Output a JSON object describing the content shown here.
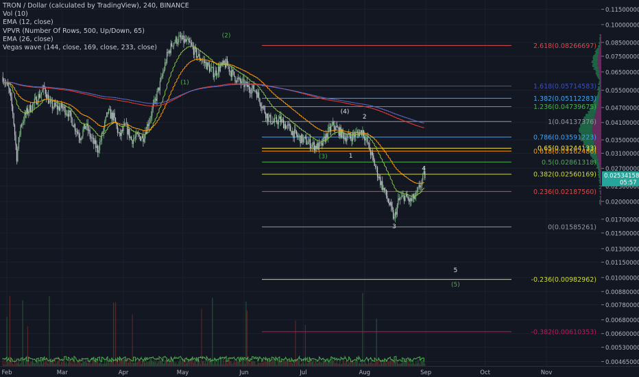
{
  "header": {
    "title": "TRON / Dollar (calculated by TradingView), 240, BINANCE",
    "indicators": [
      "Vol (10)",
      "EMA (12, close)",
      "VPVR (Number Of Rows, 500, Up/Down, 65)",
      "EMA (26, close)",
      "Vegas wave (144, close, 169, close, 233, close)"
    ]
  },
  "price_axis": {
    "ticks": [
      "0.11500000",
      "0.10000000",
      "0.08500000",
      "0.07500000",
      "0.06500000",
      "0.05500000",
      "0.04700000",
      "0.04100000",
      "0.03500000",
      "0.03100000",
      "0.02700000",
      "0.02300000",
      "0.02000000",
      "0.01700000",
      "0.01500000",
      "0.01300000",
      "0.01150000",
      "0.01000000",
      "0.00880000",
      "0.00780000",
      "0.00680000",
      "0.00600000",
      "0.00530000",
      "0.00465000"
    ],
    "last_price": "0.02534158",
    "countdown": "05:57",
    "last_price_color": "#26a69a"
  },
  "time_axis": {
    "labels": [
      "Feb",
      "Mar",
      "Apr",
      "May",
      "Jun",
      "Jul",
      "Aug",
      "Sep",
      "Oct",
      "Nov"
    ]
  },
  "fib_levels": [
    {
      "ratio": "2.618",
      "price": 0.08266697,
      "color": "#e04848"
    },
    {
      "ratio": "1.618",
      "price": 0.05714583,
      "color": "#3f51b5"
    },
    {
      "ratio": "1.382",
      "price": 0.05112283,
      "color": "#42a5f5"
    },
    {
      "ratio": "1.236",
      "price": 0.04739675,
      "color": "#4caf50"
    },
    {
      "ratio": "1",
      "price": 0.04137376,
      "color": "#9598a1"
    },
    {
      "ratio": "0.786",
      "price": 0.03591223,
      "color": "#42a5f5"
    },
    {
      "ratio": "0.65",
      "price": 0.03244133,
      "color": "#ffeb3b"
    },
    {
      "ratio": "0.618",
      "price": 0.03162486,
      "color": "#ff9800"
    },
    {
      "ratio": "0.5",
      "price": 0.02861318,
      "color": "#4caf50"
    },
    {
      "ratio": "0.382",
      "price": 0.02560169,
      "color": "#cddc39"
    },
    {
      "ratio": "0.236",
      "price": 0.0218756,
      "color": "#e04848"
    },
    {
      "ratio": "0",
      "price": 0.01585261,
      "color": "#9598a1"
    },
    {
      "ratio": "-0.236",
      "price": 0.00982962,
      "color": "#cddc39"
    },
    {
      "ratio": "-0.382",
      "price": 0.00610353,
      "color": "#c2185b"
    }
  ],
  "wave_labels": [
    {
      "text": "(1)",
      "date": "2018-05-02",
      "price": 0.058,
      "color": "#4caf50"
    },
    {
      "text": "(2)",
      "date": "2018-05-23",
      "price": 0.089,
      "color": "#4caf50"
    },
    {
      "text": "(3)",
      "date": "2018-07-11",
      "price": 0.0296,
      "color": "#4caf50"
    },
    {
      "text": "(4)",
      "date": "2018-07-22",
      "price": 0.0445,
      "color": "#e0e0e0"
    },
    {
      "text": "1",
      "date": "2018-07-25",
      "price": 0.0298,
      "color": "#e0e0e0"
    },
    {
      "text": "2",
      "date": "2018-08-01",
      "price": 0.0425,
      "color": "#e0e0e0"
    },
    {
      "text": "3",
      "date": "2018-08-16",
      "price": 0.01565,
      "color": "#e0e0e0"
    },
    {
      "text": "4",
      "date": "2018-08-31",
      "price": 0.0265,
      "color": "#e0e0e0"
    },
    {
      "text": "5",
      "date": "2018-09-16",
      "price": 0.0105,
      "color": "#e0e0e0"
    },
    {
      "text": "(5)",
      "date": "2018-09-16",
      "price": 0.0092,
      "color": "#4caf50"
    }
  ],
  "chart_data": {
    "type": "candlestick",
    "symbol": "TRXUSD",
    "interval": "240",
    "x_range": [
      "2018-01-30",
      "2018-11-30"
    ],
    "y_scale": "log",
    "y_range": [
      0.00455,
      0.122
    ],
    "close_path": [
      [
        "2018-01-30",
        0.062
      ],
      [
        "2018-02-02",
        0.055
      ],
      [
        "2018-02-04",
        0.045
      ],
      [
        "2018-02-06",
        0.03
      ],
      [
        "2018-02-08",
        0.04
      ],
      [
        "2018-02-11",
        0.045
      ],
      [
        "2018-02-14",
        0.048
      ],
      [
        "2018-02-17",
        0.052
      ],
      [
        "2018-02-20",
        0.056
      ],
      [
        "2018-02-23",
        0.048
      ],
      [
        "2018-02-26",
        0.047
      ],
      [
        "2018-03-01",
        0.047
      ],
      [
        "2018-03-04",
        0.045
      ],
      [
        "2018-03-07",
        0.04
      ],
      [
        "2018-03-10",
        0.036
      ],
      [
        "2018-03-13",
        0.04
      ],
      [
        "2018-03-16",
        0.035
      ],
      [
        "2018-03-19",
        0.032
      ],
      [
        "2018-03-21",
        0.036
      ],
      [
        "2018-03-24",
        0.045
      ],
      [
        "2018-03-27",
        0.043
      ],
      [
        "2018-03-30",
        0.036
      ],
      [
        "2018-04-02",
        0.04
      ],
      [
        "2018-04-05",
        0.035
      ],
      [
        "2018-04-08",
        0.036
      ],
      [
        "2018-04-11",
        0.036
      ],
      [
        "2018-04-14",
        0.042
      ],
      [
        "2018-04-17",
        0.05
      ],
      [
        "2018-04-20",
        0.06
      ],
      [
        "2018-04-23",
        0.075
      ],
      [
        "2018-04-26",
        0.085
      ],
      [
        "2018-04-29",
        0.088
      ],
      [
        "2018-05-02",
        0.086
      ],
      [
        "2018-05-05",
        0.083
      ],
      [
        "2018-05-08",
        0.076
      ],
      [
        "2018-05-11",
        0.072
      ],
      [
        "2018-05-14",
        0.068
      ],
      [
        "2018-05-17",
        0.064
      ],
      [
        "2018-05-20",
        0.068
      ],
      [
        "2018-05-23",
        0.07
      ],
      [
        "2018-05-26",
        0.064
      ],
      [
        "2018-05-29",
        0.06
      ],
      [
        "2018-06-01",
        0.058
      ],
      [
        "2018-06-04",
        0.056
      ],
      [
        "2018-06-07",
        0.055
      ],
      [
        "2018-06-10",
        0.048
      ],
      [
        "2018-06-13",
        0.043
      ],
      [
        "2018-06-16",
        0.041
      ],
      [
        "2018-06-19",
        0.042
      ],
      [
        "2018-06-22",
        0.04
      ],
      [
        "2018-06-25",
        0.038
      ],
      [
        "2018-06-28",
        0.036
      ],
      [
        "2018-07-01",
        0.035
      ],
      [
        "2018-07-04",
        0.034
      ],
      [
        "2018-07-07",
        0.033
      ],
      [
        "2018-07-10",
        0.033
      ],
      [
        "2018-07-13",
        0.037
      ],
      [
        "2018-07-16",
        0.04
      ],
      [
        "2018-07-19",
        0.038
      ],
      [
        "2018-07-22",
        0.036
      ],
      [
        "2018-07-25",
        0.036
      ],
      [
        "2018-07-28",
        0.037
      ],
      [
        "2018-07-31",
        0.038
      ],
      [
        "2018-08-03",
        0.033
      ],
      [
        "2018-08-06",
        0.028
      ],
      [
        "2018-08-09",
        0.024
      ],
      [
        "2018-08-12",
        0.021
      ],
      [
        "2018-08-14",
        0.019
      ],
      [
        "2018-08-16",
        0.017
      ],
      [
        "2018-08-18",
        0.02
      ],
      [
        "2018-08-21",
        0.021
      ],
      [
        "2018-08-24",
        0.02
      ],
      [
        "2018-08-27",
        0.021
      ],
      [
        "2018-08-29",
        0.023
      ],
      [
        "2018-08-31",
        0.0253
      ]
    ],
    "volume_axis_max": 50
  }
}
